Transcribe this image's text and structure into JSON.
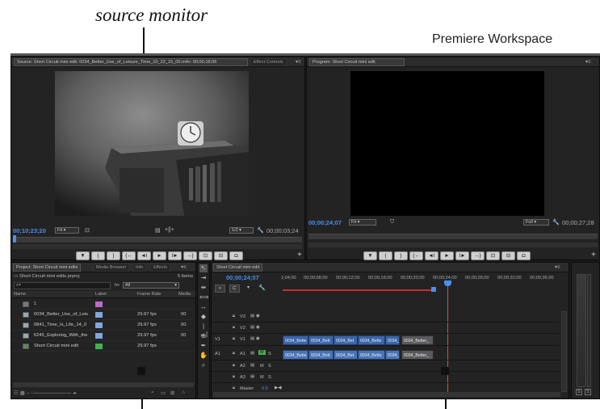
{
  "annotations": {
    "title": "source monitor",
    "subtitle": "Premiere Workspace"
  },
  "source_monitor": {
    "tab_label": "Source: Short Circuit mini edit: 0034_Better_Use_of_Leisure_Time_10_22_15_00.m4v: 00;00;18;06",
    "tab2_label": "Effect Controls",
    "timecode": "00;10;23;20",
    "fit": "Fit",
    "resolution": "1/2",
    "duration": "00;00;03;24",
    "buttons": [
      "▼",
      "{",
      "}",
      "{←",
      "◄I",
      "►",
      "I►",
      "→}",
      "⊡",
      "⊟",
      "◘"
    ],
    "plus": "+"
  },
  "program_monitor": {
    "tab_label": "Program: Short Circuit mini edit",
    "timecode": "00;00;24;07",
    "fit": "Fit",
    "resolution": "Full",
    "duration": "00;00;27;28",
    "buttons": [
      "▼",
      "{",
      "}",
      "{←",
      "◄I",
      "►",
      "I►",
      "→}",
      "⊡",
      "⊟",
      "◘"
    ],
    "plus": "+"
  },
  "project": {
    "tabs": [
      "Project: Short Circuit mini edits",
      "Media Browser",
      "Info",
      "Effects"
    ],
    "file": "Short Circuit mini edits.prproj",
    "count": "5 Items",
    "search_prefix": "⌕▾",
    "in_label": "In:",
    "in_value": "All",
    "headers": [
      "Name",
      "Label",
      "Frame Rate",
      "Media"
    ],
    "items": [
      {
        "name": "1",
        "color": "#c06ac8",
        "rate": "",
        "media": ""
      },
      {
        "name": "0034_Better_Use_of_Leis",
        "color": "#7ea6dd",
        "rate": "29.97 fps",
        "media": "00"
      },
      {
        "name": "0841_Time_Is_Life_14_0",
        "color": "#7ea6dd",
        "rate": "29.97 fps",
        "media": "00"
      },
      {
        "name": "6245_Exploring_With_the",
        "color": "#7ea6dd",
        "rate": "29.97 fps",
        "media": "00"
      },
      {
        "name": "Short Circuit mini edit",
        "color": "#3fb24c",
        "rate": "29.97 fps",
        "media": ""
      }
    ]
  },
  "timeline": {
    "tab_label": "Short Circuit mini edit",
    "timecode": "00;00;24;07",
    "ruler": [
      "1;04;00",
      "00;00;08;00",
      "00;00;12;00",
      "00;00;16;00",
      "00;00;20;00",
      "00;00;24;00",
      "00;00;28;00",
      "00;00;32;00",
      "00;00;36;00"
    ],
    "video_tracks": [
      "V3",
      "V2",
      "V1"
    ],
    "audio_tracks": [
      "A1",
      "A2",
      "A3"
    ],
    "source_patch_v": "V1",
    "source_patch_a": "A1",
    "master_label": "Master",
    "master_value": "0.0",
    "video_clips": [
      "0034_Bette",
      "0034_Bett",
      "0034_Bet",
      "0034_Bette",
      "0034_",
      "0034_Better_"
    ],
    "audio_clips": [
      "0034_Bette",
      "0034_Bett",
      "0034_Bet",
      "0034_Bette",
      "0034_",
      "0034_Better_"
    ],
    "ms_labels": [
      "M",
      "S"
    ]
  },
  "audio_meter": {
    "solo_labels": [
      "S",
      "S"
    ]
  }
}
